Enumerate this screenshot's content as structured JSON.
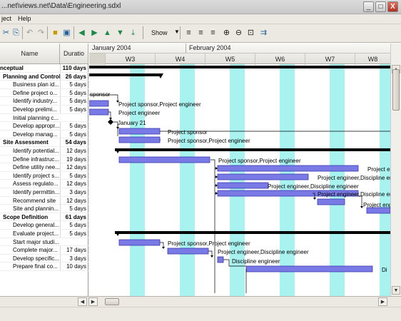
{
  "window": {
    "title": "...net\\views.net\\Data\\Engineering.sdxl",
    "min_label": "_",
    "max_label": "□",
    "close_label": "X"
  },
  "menu": {
    "items": [
      "ject",
      "Help"
    ]
  },
  "toolbar": {
    "show_label": "Show"
  },
  "columns": {
    "name_header": "Name",
    "duration_header": "Duratio"
  },
  "timeline": {
    "months": [
      "January 2004",
      "February 2004"
    ],
    "weeks": [
      "W3",
      "W4",
      "W5",
      "W6",
      "W7",
      "W8"
    ]
  },
  "tasks": [
    {
      "name": "nceptual",
      "duration": "110 days",
      "level": 0
    },
    {
      "name": "Planning and Control",
      "duration": "26 days",
      "level": 1
    },
    {
      "name": "Business plan id...",
      "duration": "5 days",
      "level": 2
    },
    {
      "name": "Define project o...",
      "duration": "5 days",
      "level": 2
    },
    {
      "name": "Identify industry...",
      "duration": "5 days",
      "level": 2
    },
    {
      "name": "Develop prelimi...",
      "duration": "5 days",
      "level": 2
    },
    {
      "name": "Initial planning c...",
      "duration": "",
      "level": 2
    },
    {
      "name": "Develop appropr...",
      "duration": "5 days",
      "level": 2
    },
    {
      "name": "Develop manag...",
      "duration": "5 days",
      "level": 2
    },
    {
      "name": "Site Assessment",
      "duration": "54 days",
      "level": 1
    },
    {
      "name": "Identify potential...",
      "duration": "12 days",
      "level": 2
    },
    {
      "name": "Define infrastruc...",
      "duration": "19 days",
      "level": 2
    },
    {
      "name": "Define utility nee...",
      "duration": "12 days",
      "level": 2
    },
    {
      "name": "Identify project s...",
      "duration": "5 days",
      "level": 2
    },
    {
      "name": "Assess regulato...",
      "duration": "12 days",
      "level": 2
    },
    {
      "name": "Identify permittin...",
      "duration": "3 days",
      "level": 2
    },
    {
      "name": "Recommend site",
      "duration": "12 days",
      "level": 2
    },
    {
      "name": "Site and plannin...",
      "duration": "5 days",
      "level": 2
    },
    {
      "name": "Scope Definition",
      "duration": "61 days",
      "level": 1
    },
    {
      "name": "Develop general...",
      "duration": "5 days",
      "level": 2
    },
    {
      "name": "Evaluate project...",
      "duration": "5 days",
      "level": 2
    },
    {
      "name": "Start major studi...",
      "duration": "",
      "level": 2
    },
    {
      "name": "Complete major...",
      "duration": "17 days",
      "level": 2
    },
    {
      "name": "Develop specific...",
      "duration": "3 days",
      "level": 2
    },
    {
      "name": "Prepare final co...",
      "duration": "10 days",
      "level": 2
    }
  ],
  "resource_labels": [
    "Project sponsor,Project engineer",
    "Project sponsor",
    "Project engineer",
    "January 21",
    "Project sponsor,Project engineer",
    "Project engineer,Discipline engineer",
    "Project engineer,Discipline engineer",
    "Discipline engineer",
    "Project engineer",
    "Project sponsor,Project engineer",
    "Project engineer,Discipline engineer",
    "Discipline engineer",
    "Di",
    "sponsor",
    "Project e"
  ],
  "colors": {
    "bar_fill": "#7a7ae6",
    "bar_stroke": "#3a3ab0",
    "summary": "#000000",
    "weekend": "#a8f2f0"
  }
}
